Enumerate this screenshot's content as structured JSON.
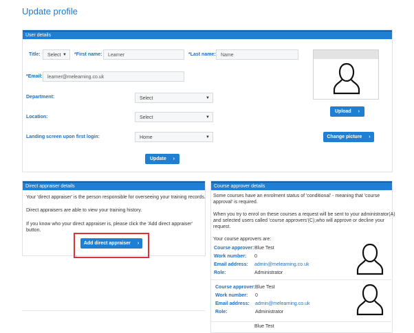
{
  "page": {
    "title": "Update profile"
  },
  "user_details": {
    "header": "User details",
    "title_label": "Title:",
    "title_value": "Select",
    "first_name_label": "*First name:",
    "first_name_value": "Learner",
    "last_name_label": "*Last name:",
    "last_name_value": "Name",
    "email_label": "*Email:",
    "email_value": "learner@melearning.co.uk",
    "department_label": "Department:",
    "department_value": "Select",
    "location_label": "Location:",
    "location_value": "Select",
    "landing_label": "Landing screen upon first login:",
    "landing_value": "Home",
    "update_button": "Update"
  },
  "picture": {
    "upload_button": "Upload",
    "change_button": "Change picture"
  },
  "appraiser": {
    "header": "Direct appraiser details",
    "p1": "Your 'direct appraiser' is the person responsible for overseeing your training records.",
    "p2": "Direct appraisers are able to view your training history.",
    "p3a": "If you know who your direct appraiser is, please click the 'Add direct appraiser'",
    "p3b": "button.",
    "add_button": "Add direct appraiser"
  },
  "course_approver": {
    "header": "Course approver details",
    "p1a": "Some courses have an enrolment status of 'conditional' - meaning that 'course",
    "p1b": "approval' is required.",
    "p2a": "When you try to enrol on these courses a request will be sent to your administrator(A)",
    "p2b": "and selected users called 'course approvers'(C),who will approve or decline your",
    "p2c": "request.",
    "p3": "Your course approvers are:",
    "approvers": [
      {
        "approver_label": "Course approver:",
        "approver_value": "Blue Test",
        "work_label": "Work number:",
        "work_value": "0",
        "email_label": "Email address:",
        "email_value": "admin@melearning.co.uk",
        "role_label": "Role:",
        "role_value": "Administrator"
      },
      {
        "approver_label": "Course approver:",
        "approver_value": "Blue Test",
        "work_label": "Work number:",
        "work_value": "0",
        "email_label": "Email address:",
        "email_value": "admin@melearning.co.uk",
        "role_label": "Role:",
        "role_value": "Administrator"
      }
    ],
    "partial_text": "Blue Test"
  },
  "icons": {
    "avatar": "user-silhouette-icon",
    "arrow": "chevron-right-icon",
    "dropdown": "caret-down-icon"
  },
  "colors": {
    "accent": "#1e7fd3",
    "highlight": "#e03030"
  }
}
